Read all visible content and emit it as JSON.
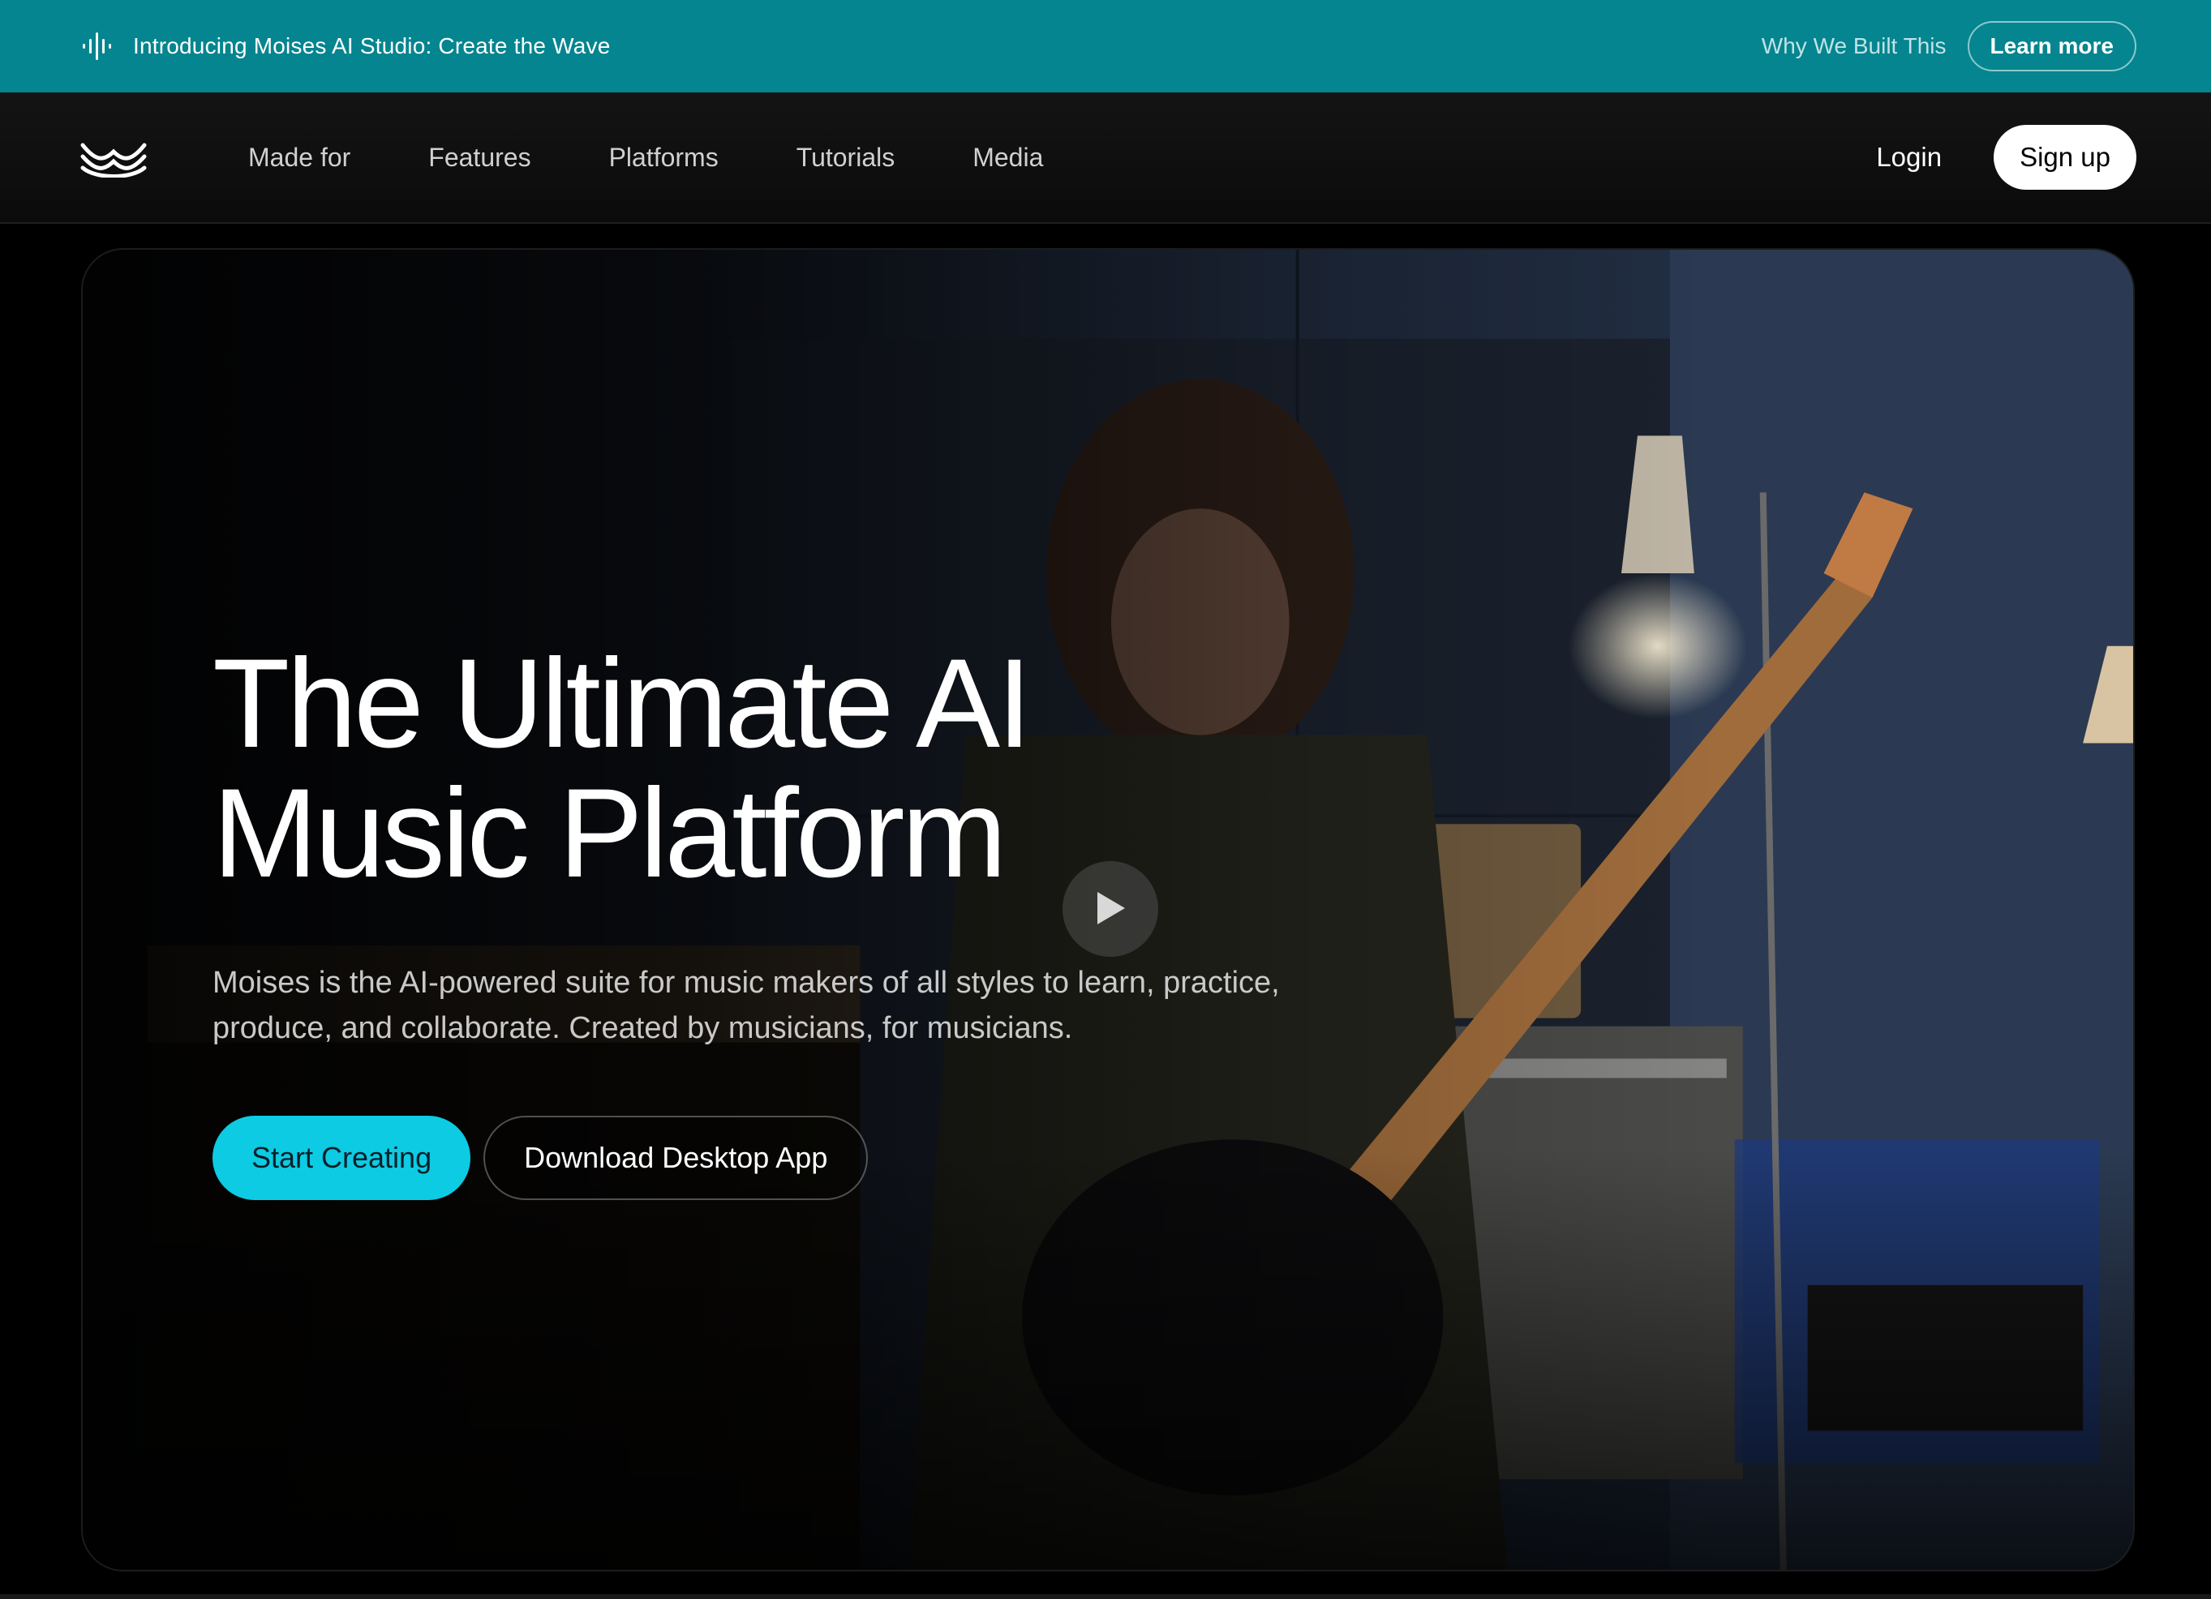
{
  "banner": {
    "icon": "audio-wave-icon",
    "text": "Introducing Moises AI Studio: Create the Wave",
    "why_link": "Why We Built This",
    "learn_more": "Learn more",
    "color": "#04858f"
  },
  "nav": {
    "logo": "moises-logo-icon",
    "links": [
      {
        "label": "Made for"
      },
      {
        "label": "Features"
      },
      {
        "label": "Platforms"
      },
      {
        "label": "Tutorials"
      },
      {
        "label": "Media"
      }
    ],
    "login": "Login",
    "signup": "Sign up"
  },
  "hero": {
    "title": "The Ultimate AI\nMusic Platform",
    "subtitle": "Moises is the AI-powered suite for music makers of all styles to learn, practice, produce, and collaborate. Created by musicians, for musicians.",
    "primary_button": "Start Creating",
    "secondary_button": "Download Desktop App",
    "play_icon": "play-icon",
    "accent_color": "#0ccbe3"
  }
}
